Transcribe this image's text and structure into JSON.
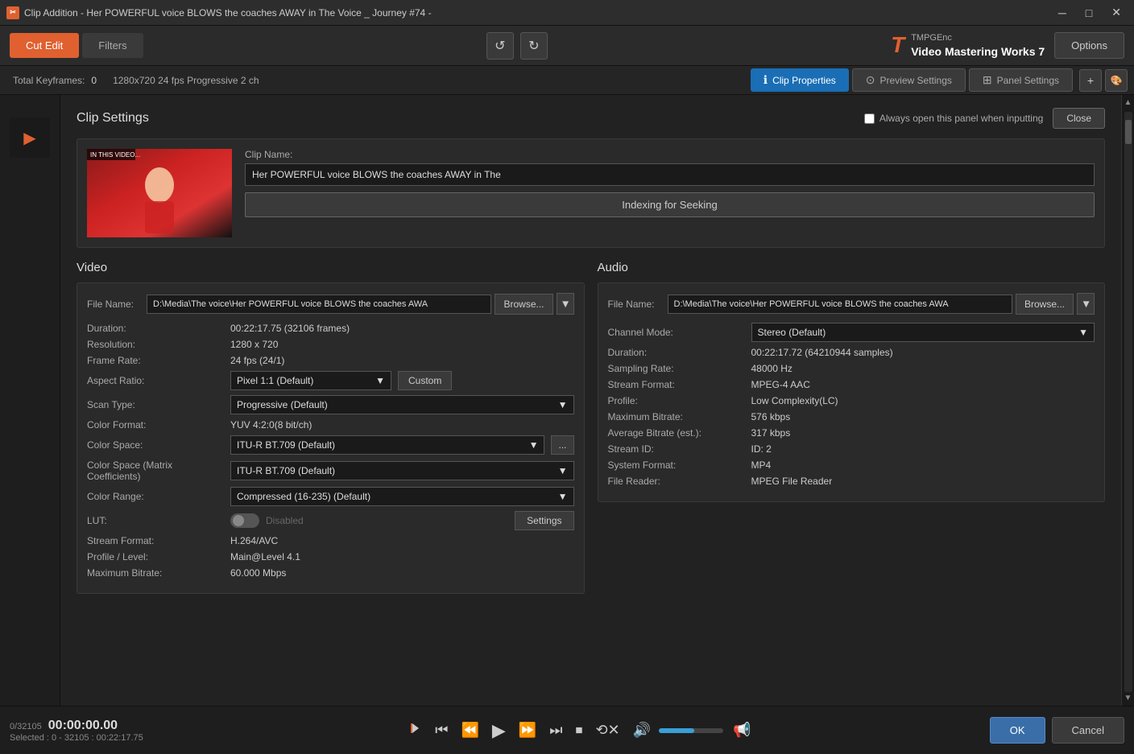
{
  "window": {
    "title": "Clip Addition - Her POWERFUL voice BLOWS the coaches AWAY in The Voice _ Journey #74 -"
  },
  "toolbar": {
    "cut_edit_label": "Cut Edit",
    "filters_label": "Filters",
    "options_label": "Options",
    "brand_line1": "TMPGEnc",
    "brand_line2": "Video Mastering Works 7"
  },
  "info_bar": {
    "keyframes_label": "Total Keyframes:",
    "keyframes_value": "0",
    "resolution_fps": "1280x720  24 fps  Progressive  2 ch",
    "clip_properties_label": "Clip Properties",
    "preview_settings_label": "Preview Settings",
    "panel_settings_label": "Panel Settings"
  },
  "clip_settings": {
    "title": "Clip Settings",
    "always_open_label": "Always open this panel when inputting",
    "close_label": "Close",
    "clip_name_label": "Clip Name:",
    "clip_name_value": "Her POWERFUL voice BLOWS the coaches AWAY in The",
    "indexing_label": "Indexing for Seeking",
    "thumbnail_overlay": "IN THIS VIDEO...",
    "video": {
      "title": "Video",
      "file_name_label": "File Name:",
      "file_name_value": "D:\\Media\\The voice\\Her POWERFUL voice BLOWS the coaches AWA",
      "browse_label": "Browse...",
      "duration_label": "Duration:",
      "duration_value": "00:22:17.75 (32106  frames)",
      "resolution_label": "Resolution:",
      "resolution_value": "1280 x 720",
      "frame_rate_label": "Frame Rate:",
      "frame_rate_value": "24 fps (24/1)",
      "aspect_ratio_label": "Aspect Ratio:",
      "aspect_ratio_value": "Pixel 1:1 (Default)",
      "custom_label": "Custom",
      "scan_type_label": "Scan Type:",
      "scan_type_value": "Progressive (Default)",
      "color_format_label": "Color Format:",
      "color_format_value": "YUV 4:2:0(8 bit/ch)",
      "color_space_label": "Color Space:",
      "color_space_value": "ITU-R BT.709 (Default)",
      "color_space_matrix_label": "Color Space (Matrix Coefficients)",
      "color_space_matrix_value": "ITU-R BT.709 (Default)",
      "color_range_label": "Color Range:",
      "color_range_value": "Compressed (16-235) (Default)",
      "lut_label": "LUT:",
      "lut_status": "Disabled",
      "settings_label": "Settings",
      "stream_format_label": "Stream Format:",
      "stream_format_value": "H.264/AVC",
      "profile_level_label": "Profile / Level:",
      "profile_level_value": "Main@Level 4.1",
      "max_bitrate_label": "Maximum Bitrate:",
      "max_bitrate_value": "60.000 Mbps"
    },
    "audio": {
      "title": "Audio",
      "file_name_label": "File Name:",
      "file_name_value": "D:\\Media\\The voice\\Her POWERFUL voice BLOWS the coaches AWA",
      "browse_label": "Browse...",
      "channel_mode_label": "Channel Mode:",
      "channel_mode_value": "Stereo (Default)",
      "duration_label": "Duration:",
      "duration_value": "00:22:17.72 (64210944  samples)",
      "sampling_rate_label": "Sampling Rate:",
      "sampling_rate_value": "48000 Hz",
      "stream_format_label": "Stream Format:",
      "stream_format_value": "MPEG-4 AAC",
      "profile_label": "Profile:",
      "profile_value": "Low Complexity(LC)",
      "max_bitrate_label": "Maximum Bitrate:",
      "max_bitrate_value": "576 kbps",
      "avg_bitrate_label": "Average Bitrate (est.):",
      "avg_bitrate_value": "317 kbps",
      "stream_id_label": "Stream ID:",
      "stream_id_value": "ID: 2",
      "system_format_label": "System Format:",
      "system_format_value": "MP4",
      "file_reader_label": "File Reader:",
      "file_reader_value": "MPEG File Reader"
    }
  },
  "playback": {
    "frame_counter": "0/32105",
    "timecode": "00:00:00.00",
    "selection": "Selected : 0 - 32105 : 00:22:17.75",
    "ok_label": "OK",
    "cancel_label": "Cancel"
  }
}
